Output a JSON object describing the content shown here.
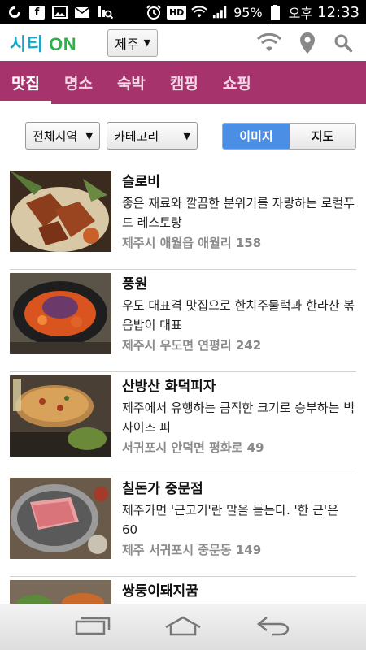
{
  "statusbar": {
    "battery": "95%",
    "ampm": "오후",
    "time": "12:33",
    "hd": "HD"
  },
  "header": {
    "brand_main": "시티",
    "brand_on": "ON",
    "region": "제주"
  },
  "tabs": [
    "맛집",
    "명소",
    "숙박",
    "캠핑",
    "쇼핑"
  ],
  "filters": {
    "area": "전체지역",
    "category": "카테고리",
    "view_image": "이미지",
    "view_map": "지도"
  },
  "items": [
    {
      "title": "슬로비",
      "desc": "좋은 재료와 깔끔한 분위기를 자랑하는 로컬푸드 레스토랑",
      "addr": "제주시 애월읍 애월리 158"
    },
    {
      "title": "풍원",
      "desc": "우도 대표격 맛집으로 한치주물럭과 한라산 볶음밥이 대표",
      "addr": "제주시 우도면 연평리 242"
    },
    {
      "title": "산방산 화덕피자",
      "desc": "제주에서 유행하는 큼직한 크기로 승부하는 빅 사이즈 피",
      "addr": "서귀포시 안덕면 평화로 49"
    },
    {
      "title": "칠돈가 중문점",
      "desc": "제주가면 '근고기'란 말을 듣는다. '한 근'은 60",
      "addr": "제주 서귀포시 중문동 149"
    },
    {
      "title": "쌍둥이돼지꿈",
      "desc": "",
      "addr": ""
    }
  ]
}
